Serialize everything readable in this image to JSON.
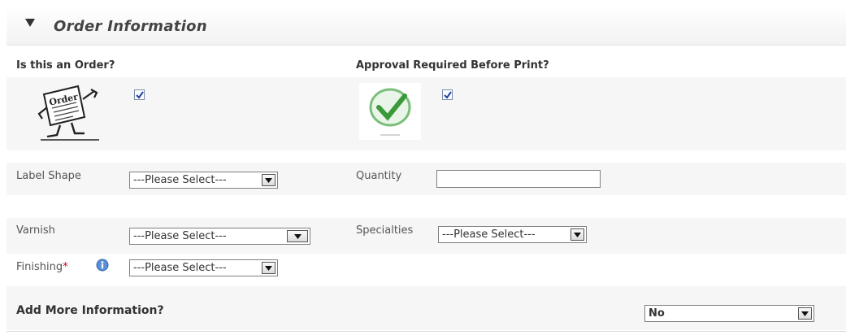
{
  "section": {
    "title": "Order Information",
    "collapse_state": "expanded"
  },
  "order": {
    "label": "Is this an Order?",
    "checked": true,
    "image_icon": "order-clipart-icon"
  },
  "approval": {
    "label": "Approval Required Before Print?",
    "checked": true,
    "image_icon": "checkmark-badge-icon"
  },
  "fields": {
    "label_shape": {
      "label": "Label Shape",
      "value": "---Please Select---"
    },
    "quantity": {
      "label": "Quantity",
      "value": ""
    },
    "varnish": {
      "label": "Varnish",
      "value": "---Please Select---"
    },
    "specialties": {
      "label": "Specialties",
      "value": "---Please Select---"
    },
    "finishing": {
      "label": "Finishing",
      "required_mark": "*",
      "value": "---Please Select---"
    }
  },
  "more_info": {
    "label": "Add More Information?",
    "value": "No"
  },
  "colors": {
    "required": "#d0021b",
    "check": "#1b3fa3",
    "accent_green": "#3a9a3a"
  }
}
